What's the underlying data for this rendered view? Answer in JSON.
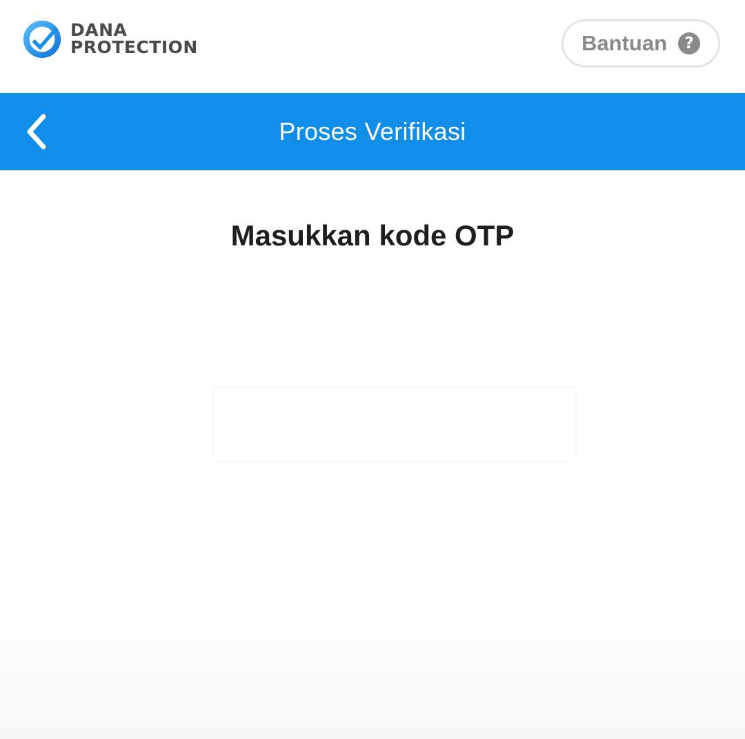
{
  "brand": {
    "line1": "DANA",
    "line2": "PROTECTION",
    "logo_icon": "check-shield-icon",
    "logo_color": "#1a8fe3"
  },
  "help_button": {
    "label": "Bantuan",
    "icon": "question-circle-icon"
  },
  "header": {
    "title": "Proses Verifikasi",
    "back_icon": "chevron-left-icon",
    "background": "#118ee9"
  },
  "main": {
    "heading": "Masukkan kode OTP"
  }
}
